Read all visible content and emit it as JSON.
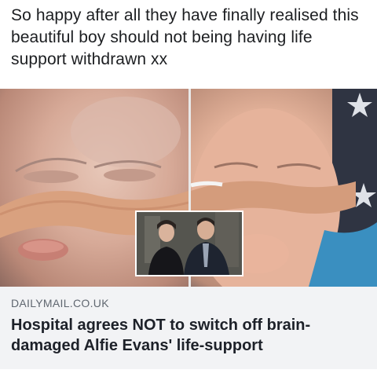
{
  "post": {
    "text": "So happy after all they have finally realised this beautiful boy should not being having life support withdrawn xx"
  },
  "link_preview": {
    "domain": "DAILYMAIL.CO.UK",
    "headline": "Hospital agrees NOT to switch off brain-damaged Alfie Evans' life-support"
  },
  "colors": {
    "card_background": "#f2f3f5",
    "headline_text": "#1d2129",
    "domain_text": "#606770"
  }
}
